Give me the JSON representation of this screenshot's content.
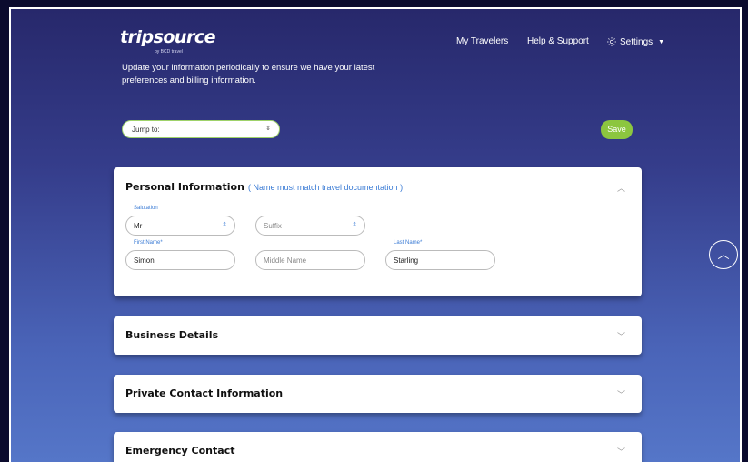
{
  "brand": {
    "name": "tripsource",
    "sub": "by BCD travel"
  },
  "intro": "Update your information periodically to ensure we have your latest preferences and billing information.",
  "nav": {
    "travelers": "My Travelers",
    "help": "Help & Support",
    "settings": "Settings"
  },
  "jump": {
    "label": "Jump to:"
  },
  "save_label": "Save",
  "personal": {
    "title": "Personal Information",
    "note": "( Name must match travel documentation )",
    "salutation_label": "Salutation",
    "salutation_value": "Mr",
    "suffix_placeholder": "Suffix",
    "first_label": "First Name*",
    "first_value": "Simon",
    "middle_placeholder": "Middle Name",
    "last_label": "Last Name*",
    "last_value": "Starling"
  },
  "sections": [
    {
      "title": "Business Details"
    },
    {
      "title": "Private Contact Information"
    },
    {
      "title": "Emergency Contact"
    }
  ],
  "icons": {
    "settings": "gear-icon",
    "collapse": "chevron-up-icon",
    "expand": "chevron-down-icon",
    "scroll": "chevron-up-circle-icon"
  },
  "colors": {
    "accent": "#8cc63f",
    "link": "#3a7bd5",
    "bg_top": "#27286b",
    "bg_bottom": "#5576c8"
  }
}
